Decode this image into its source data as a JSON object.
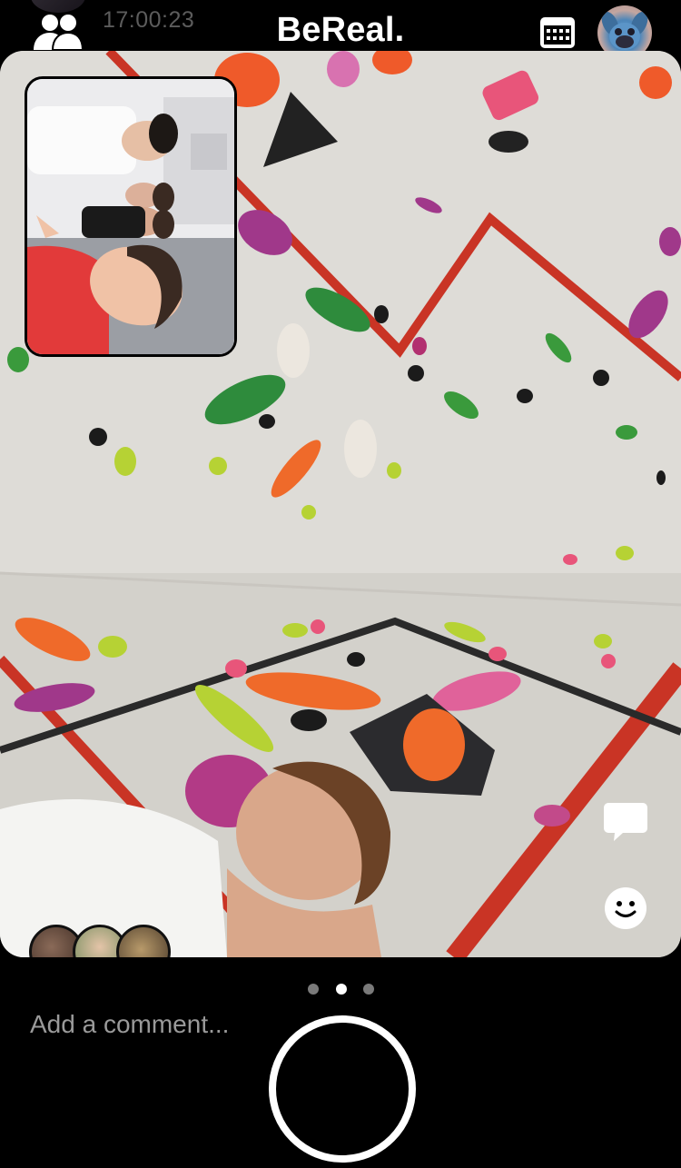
{
  "header": {
    "timestamp": "17:00:23",
    "logo": "BeReal.",
    "friends_icon": "friends-icon",
    "calendar_icon": "calendar-icon",
    "profile_icon": "profile-avatar"
  },
  "post": {
    "main_photo_desc_icon": "climbing-wall-photo",
    "front_photo_icon": "group-selfie-photo",
    "realmoji_count": 3
  },
  "actions": {
    "comment_icon": "comment-bubble-icon",
    "emoji_icon": "smiley-icon"
  },
  "pager": {
    "count": 3,
    "active_index": 1
  },
  "comment": {
    "placeholder": "Add a comment..."
  },
  "colors": {
    "background": "#000000",
    "text": "#ffffff",
    "muted": "#9a9a9a",
    "wall_line_red": "#d23a2a"
  }
}
